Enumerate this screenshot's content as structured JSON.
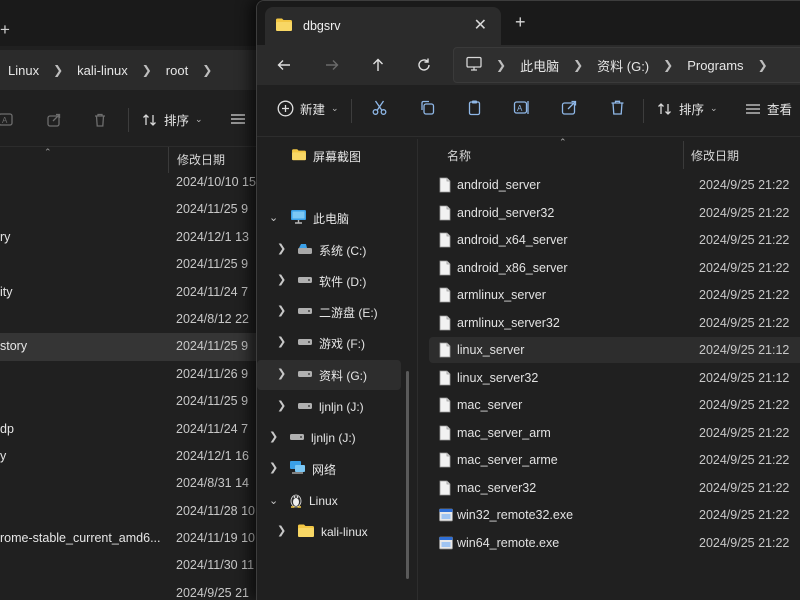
{
  "back_window": {
    "breadcrumbs": [
      "Linux",
      "kali-linux",
      "root"
    ],
    "column_date": "修改日期",
    "rows": [
      {
        "name": "",
        "date": "2024/10/10 15"
      },
      {
        "name": "",
        "date": "2024/11/25 9"
      },
      {
        "name": "ry",
        "date": "2024/12/1 13"
      },
      {
        "name": "",
        "date": "2024/11/25 9"
      },
      {
        "name": "ity",
        "date": "2024/11/24 7"
      },
      {
        "name": "",
        "date": "2024/8/12 22"
      },
      {
        "name": "story",
        "date": "2024/11/25 9"
      },
      {
        "name": "",
        "date": "2024/11/26 9"
      },
      {
        "name": "",
        "date": "2024/11/25 9"
      },
      {
        "name": "dp",
        "date": "2024/11/24 7"
      },
      {
        "name": "y",
        "date": "2024/12/1 16"
      },
      {
        "name": "",
        "date": "2024/8/31 14"
      },
      {
        "name": "",
        "date": "2024/11/28 10"
      },
      {
        "name": "rome-stable_current_amd6...",
        "date": "2024/11/19 10"
      },
      {
        "name": "",
        "date": "2024/11/30 11"
      },
      {
        "name": "",
        "date": "2024/9/25 21"
      }
    ]
  },
  "window": {
    "tab_title": "dbgsrv",
    "new_tab": "+",
    "close": "✕"
  },
  "address": {
    "segments": [
      "此电脑",
      "资料 (G:)",
      "Programs"
    ]
  },
  "toolbar": {
    "new_label": "新建",
    "sort_label": "排序",
    "view_label": "查看"
  },
  "nav_pane": {
    "items": [
      {
        "label": "屏幕截图"
      },
      {
        "label": "此电脑"
      },
      {
        "label": "系统 (C:)"
      },
      {
        "label": "软件 (D:)"
      },
      {
        "label": "二游盘 (E:)"
      },
      {
        "label": "游戏 (F:)"
      },
      {
        "label": "资料 (G:)"
      },
      {
        "label": "ljnljn (J:)"
      },
      {
        "label": "ljnljn (J:)"
      },
      {
        "label": "网络"
      },
      {
        "label": "Linux"
      },
      {
        "label": "kali-linux"
      }
    ]
  },
  "file_list": {
    "columns": {
      "name": "名称",
      "date": "修改日期"
    },
    "files": [
      {
        "name": "android_server",
        "date": "2024/9/25 21:22",
        "icon": "file-icon"
      },
      {
        "name": "android_server32",
        "date": "2024/9/25 21:22",
        "icon": "file-icon"
      },
      {
        "name": "android_x64_server",
        "date": "2024/9/25 21:22",
        "icon": "file-icon"
      },
      {
        "name": "android_x86_server",
        "date": "2024/9/25 21:22",
        "icon": "file-icon"
      },
      {
        "name": "armlinux_server",
        "date": "2024/9/25 21:22",
        "icon": "file-icon"
      },
      {
        "name": "armlinux_server32",
        "date": "2024/9/25 21:22",
        "icon": "file-icon"
      },
      {
        "name": "linux_server",
        "date": "2024/9/25 21:12",
        "icon": "file-icon"
      },
      {
        "name": "linux_server32",
        "date": "2024/9/25 21:12",
        "icon": "file-icon"
      },
      {
        "name": "mac_server",
        "date": "2024/9/25 21:22",
        "icon": "file-icon"
      },
      {
        "name": "mac_server_arm",
        "date": "2024/9/25 21:22",
        "icon": "file-icon"
      },
      {
        "name": "mac_server_arme",
        "date": "2024/9/25 21:22",
        "icon": "file-icon"
      },
      {
        "name": "mac_server32",
        "date": "2024/9/25 21:22",
        "icon": "file-icon"
      },
      {
        "name": "win32_remote32.exe",
        "date": "2024/9/25 21:22",
        "icon": "exe-icon"
      },
      {
        "name": "win64_remote.exe",
        "date": "2024/9/25 21:22",
        "icon": "exe-icon"
      }
    ]
  },
  "colors": {
    "window_bg": "#202020",
    "titlebar_bg": "#1a1a1a",
    "tab_bg": "#2b2b2b",
    "folder_yellow": "#f3c744",
    "pc_blue": "#3aa0e8",
    "selection": "#2d2d2d"
  }
}
